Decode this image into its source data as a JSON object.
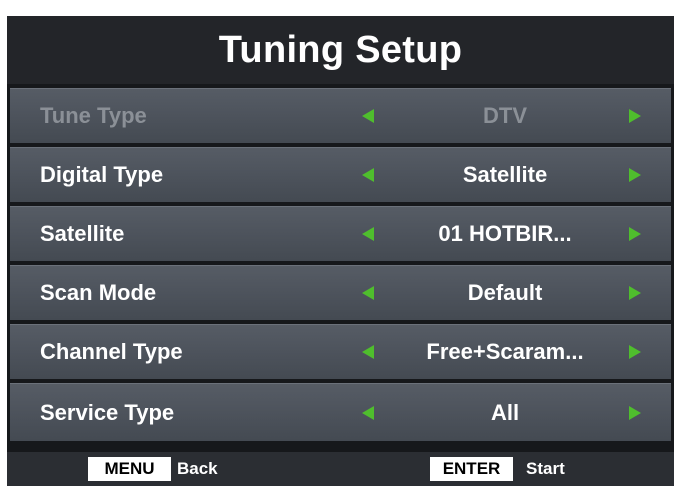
{
  "title": "Tuning Setup",
  "rows": [
    {
      "label": "Tune Type",
      "value": "DTV",
      "state": "disabled"
    },
    {
      "label": "Digital Type",
      "value": "Satellite",
      "state": "enabled"
    },
    {
      "label": "Satellite",
      "value": "01 HOTBIR...",
      "state": "enabled"
    },
    {
      "label": "Scan Mode",
      "value": "Default",
      "state": "enabled"
    },
    {
      "label": "Channel Type",
      "value": "Free+Scaram...",
      "state": "enabled"
    },
    {
      "label": "Service Type",
      "value": "All",
      "state": "enabled"
    }
  ],
  "footer": {
    "menu_key": "MENU",
    "menu_action": "Back",
    "enter_key": "ENTER",
    "enter_action": "Start"
  },
  "colors": {
    "accent_arrow": "#4fbe2d",
    "background": "#16181b",
    "row": "#4d535c",
    "disabled_text": "#8b9097"
  },
  "icons": {
    "left": "arrow-left-icon",
    "right": "arrow-right-icon"
  }
}
